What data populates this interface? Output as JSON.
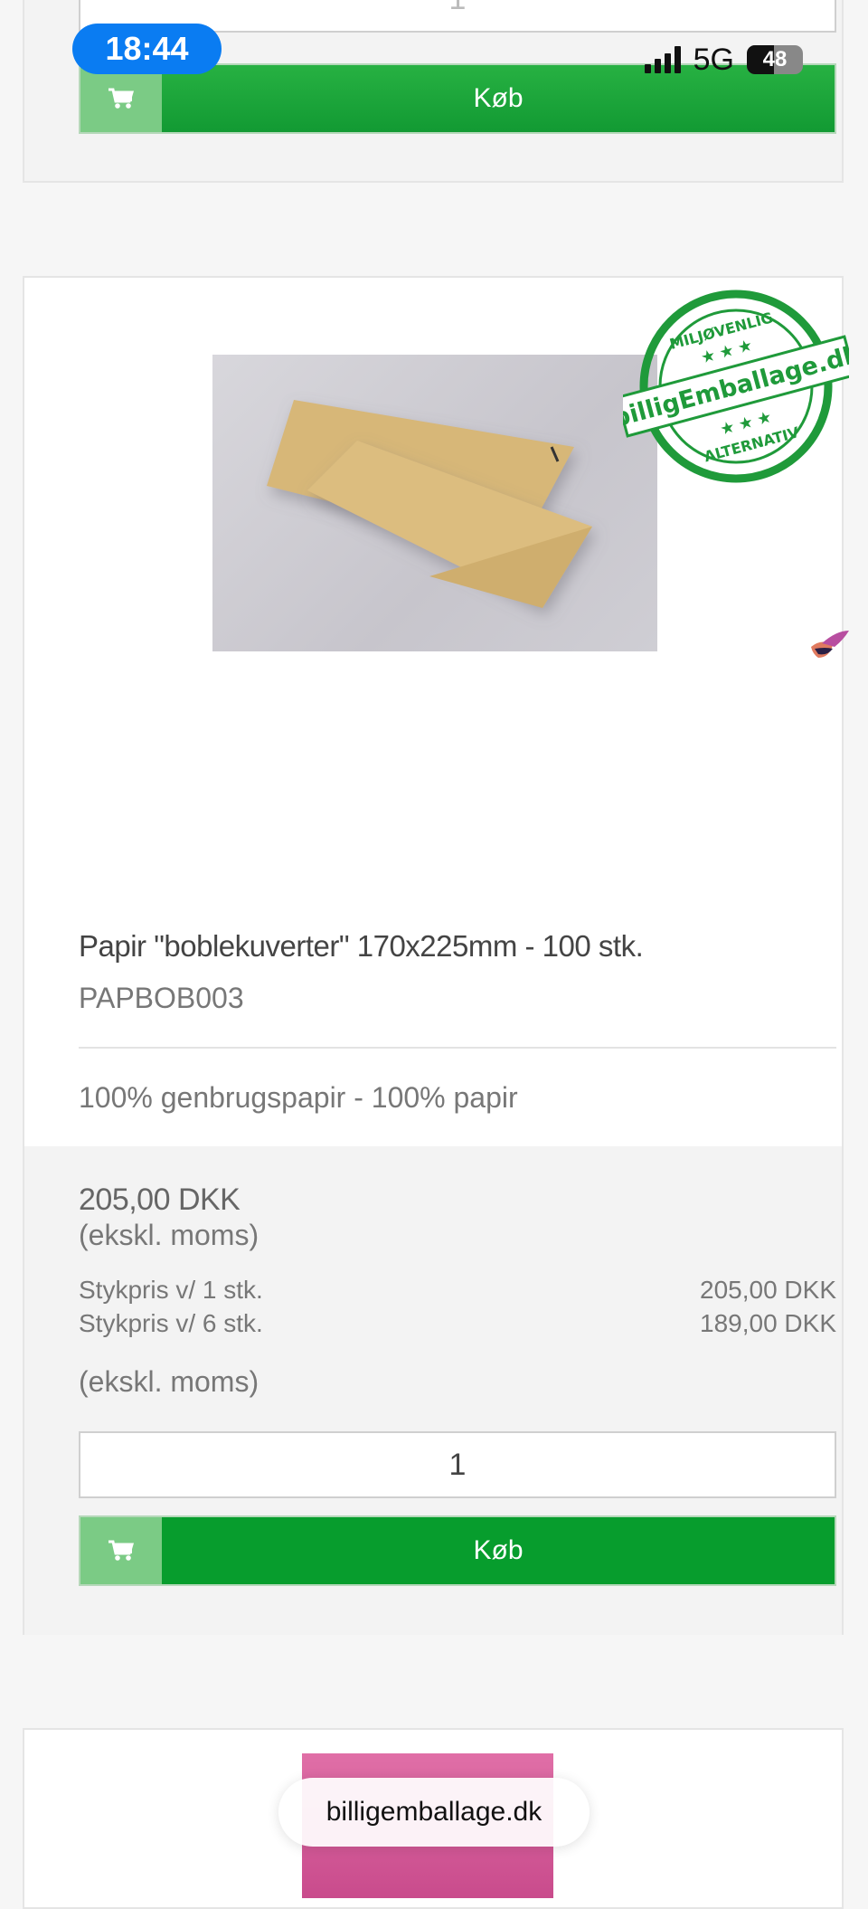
{
  "status_bar": {
    "time": "18:44",
    "network": "5G",
    "battery": "48"
  },
  "top_card": {
    "qty_value": "1",
    "buy_label": "Køb"
  },
  "product": {
    "badge_lines": [
      "MILJØVENLIG",
      "billigEmballage.dk",
      "ALTERNATIV"
    ],
    "title": "Papir \"boblekuverter\" 170x225mm - 100 stk.",
    "sku": "PAPBOB003",
    "description": "100% genbrugspapir - 100% papir",
    "price": "205,00 DKK",
    "vat_note": "(ekskl. moms)",
    "tiers": [
      {
        "label": "Stykpris v/ 1 stk.",
        "price": "205,00 DKK"
      },
      {
        "label": "Stykpris v/ 6 stk.",
        "price": "189,00 DKK"
      }
    ],
    "vat_note_2": "(ekskl. moms)",
    "qty_value": "1",
    "buy_label": "Køb"
  },
  "bottom_bar": {
    "site_name": "billigemballage.dk"
  },
  "colors": {
    "buy_green": "#079d2d",
    "cart_green": "#7bcb85",
    "badge_green": "#1f9a3a",
    "status_blue": "#0a7cf2"
  }
}
